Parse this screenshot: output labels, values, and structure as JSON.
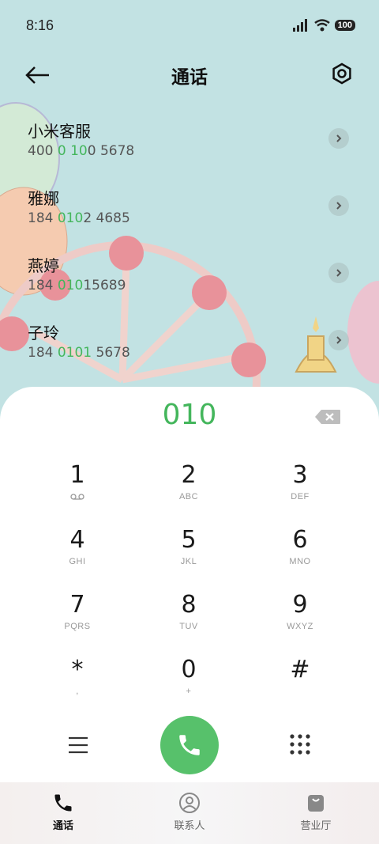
{
  "status_bar": {
    "time": "8:16",
    "battery": "100"
  },
  "header": {
    "title": "通话"
  },
  "contacts": [
    {
      "name": "小米客服",
      "num_pre": "400 ",
      "num_hl": "0 10",
      "num_post": "0 5678"
    },
    {
      "name": "雅娜",
      "num_pre": "184 ",
      "num_hl": "010",
      "num_post": "2 4685"
    },
    {
      "name": "燕婷",
      "num_pre": "184 ",
      "num_hl": "010",
      "num_post": "15689"
    },
    {
      "name": "子玲",
      "num_pre": "184 ",
      "num_hl": "0101",
      "num_post": " 5678"
    }
  ],
  "dialer": {
    "dialed_number": "010",
    "keys": [
      {
        "digit": "1",
        "letters": ""
      },
      {
        "digit": "2",
        "letters": "ABC"
      },
      {
        "digit": "3",
        "letters": "DEF"
      },
      {
        "digit": "4",
        "letters": "GHI"
      },
      {
        "digit": "5",
        "letters": "JKL"
      },
      {
        "digit": "6",
        "letters": "MNO"
      },
      {
        "digit": "7",
        "letters": "PQRS"
      },
      {
        "digit": "8",
        "letters": "TUV"
      },
      {
        "digit": "9",
        "letters": "WXYZ"
      },
      {
        "digit": "*",
        "letters": ","
      },
      {
        "digit": "0",
        "letters": "+"
      },
      {
        "digit": "#",
        "letters": ""
      }
    ]
  },
  "bottom_nav": [
    {
      "label": "通话",
      "icon": "phone-icon",
      "active": true
    },
    {
      "label": "联系人",
      "icon": "contact-icon",
      "active": false
    },
    {
      "label": "营业厅",
      "icon": "bag-icon",
      "active": false
    }
  ],
  "colors": {
    "accent": "#44b65c",
    "call_button": "#57c16b",
    "background": "#c2e2e3"
  }
}
